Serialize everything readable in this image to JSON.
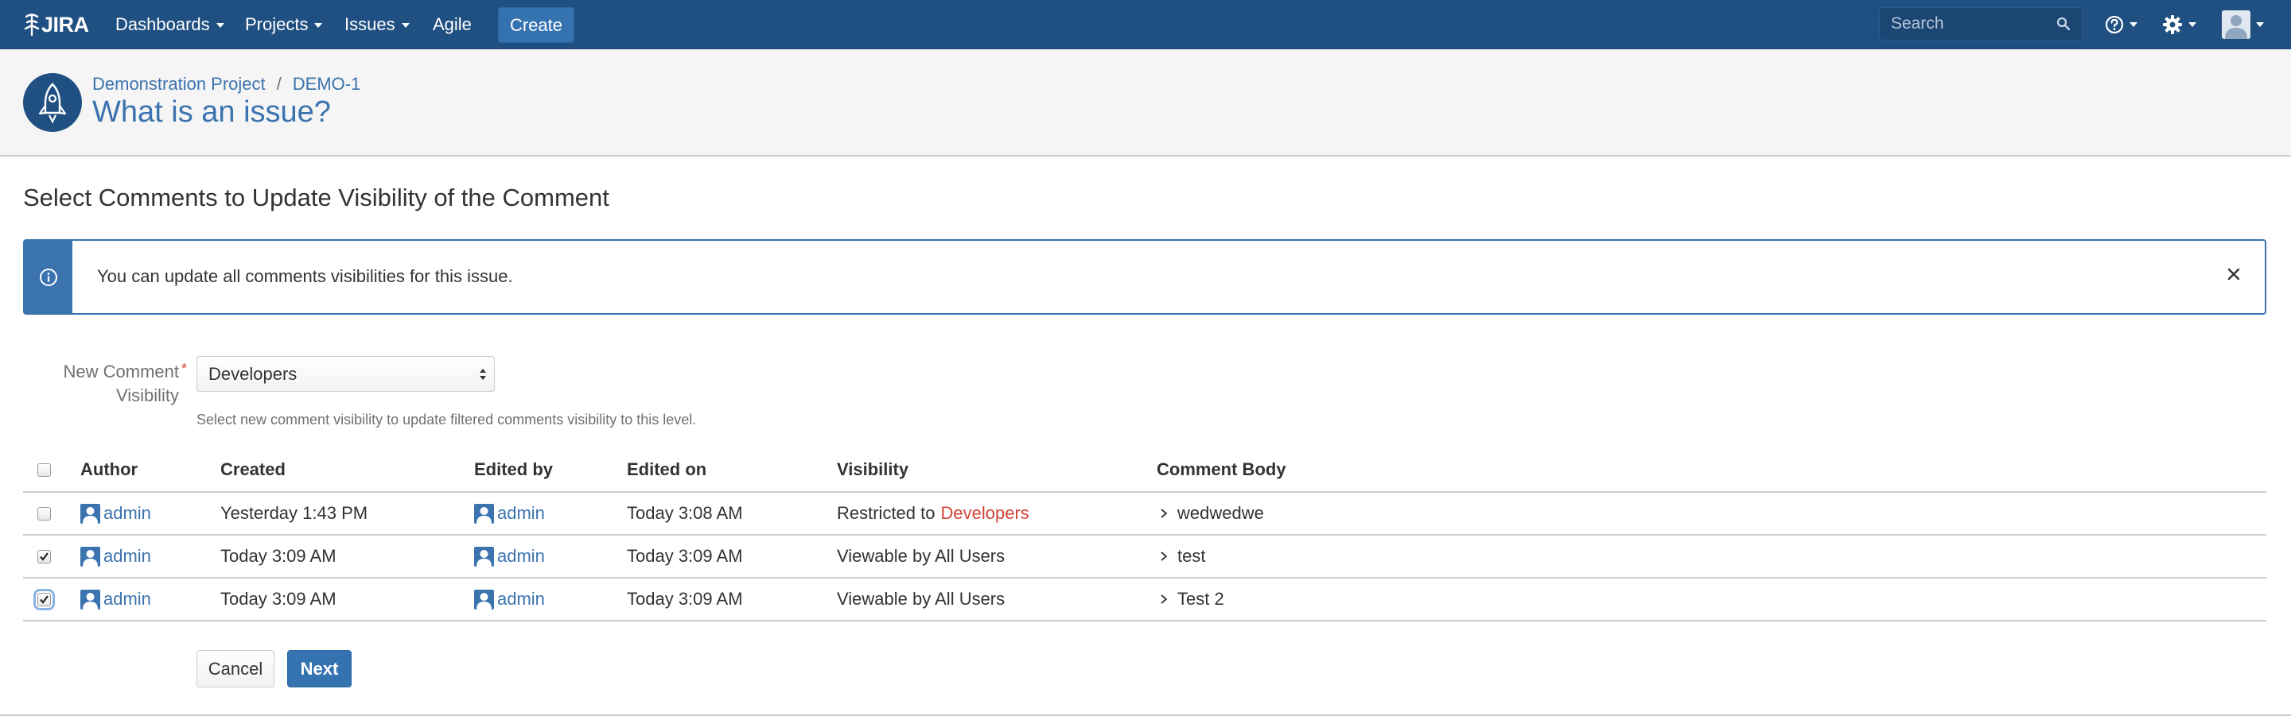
{
  "topnav": {
    "logo_text": "JIRA",
    "menus": [
      {
        "label": "Dashboards",
        "has_caret": true
      },
      {
        "label": "Projects",
        "has_caret": true
      },
      {
        "label": "Issues",
        "has_caret": true
      },
      {
        "label": "Agile",
        "has_caret": false
      }
    ],
    "create_label": "Create",
    "search_placeholder": "Search",
    "icons": [
      "help-icon",
      "gear-icon",
      "user-avatar-icon"
    ],
    "bg_color": "#205081"
  },
  "header": {
    "project_link": "Demonstration Project",
    "issue_key": "DEMO-1",
    "separator": "/",
    "title": "What is an issue?"
  },
  "main": {
    "section_title": "Select Comments to Update Visibility of the Comment",
    "info_message": "You can update all comments visibilities for this issue.",
    "visibility_field": {
      "label_line1": "New Comment",
      "label_line2": "Visibility",
      "required_marker": "*",
      "selected": "Developers",
      "description": "Select new comment visibility to update filtered comments visibility to this level."
    },
    "table": {
      "columns": [
        "Author",
        "Created",
        "Edited by",
        "Edited on",
        "Visibility",
        "Comment Body"
      ],
      "rows": [
        {
          "checked": false,
          "author": "admin",
          "created": "Yesterday 1:43 PM",
          "edited_by": "admin",
          "edited_on": "Today 3:08 AM",
          "visibility_prefix": "Restricted to",
          "visibility_group": "Developers",
          "body": "wedwedwe"
        },
        {
          "checked": true,
          "author": "admin",
          "created": "Today 3:09 AM",
          "edited_by": "admin",
          "edited_on": "Today 3:09 AM",
          "visibility_prefix": "Viewable by All Users",
          "visibility_group": "",
          "body": "test"
        },
        {
          "checked": true,
          "author": "admin",
          "created": "Today 3:09 AM",
          "edited_by": "admin",
          "edited_on": "Today 3:09 AM",
          "visibility_prefix": "Viewable by All Users",
          "visibility_group": "",
          "body": "Test 2"
        }
      ]
    },
    "buttons": {
      "cancel": "Cancel",
      "next": "Next"
    }
  },
  "colors": {
    "link": "#3b73af",
    "restricted": "#d04437",
    "primary_button": "#3572b0"
  }
}
